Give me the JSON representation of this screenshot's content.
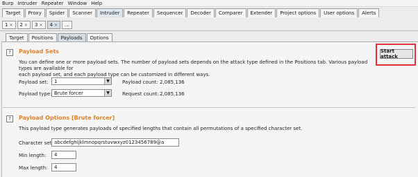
{
  "menubar": [
    "Burp",
    "Intruder",
    "Repeater",
    "Window",
    "Help"
  ],
  "main_tabs": [
    {
      "label": "Target",
      "active": false
    },
    {
      "label": "Proxy",
      "active": false
    },
    {
      "label": "Spider",
      "active": false
    },
    {
      "label": "Scanner",
      "active": false
    },
    {
      "label": "Intruder",
      "active": true
    },
    {
      "label": "Repeater",
      "active": false
    },
    {
      "label": "Sequencer",
      "active": false
    },
    {
      "label": "Decoder",
      "active": false
    },
    {
      "label": "Comparer",
      "active": false
    },
    {
      "label": "Extender",
      "active": false
    },
    {
      "label": "Project options",
      "active": false
    },
    {
      "label": "User options",
      "active": false
    },
    {
      "label": "Alerts",
      "active": false
    }
  ],
  "attack_tabs": [
    {
      "label": "1",
      "close": "×",
      "active": false
    },
    {
      "label": "2",
      "close": "×",
      "active": false
    },
    {
      "label": "3",
      "close": "×",
      "active": false
    },
    {
      "label": "4",
      "close": "×",
      "active": true
    },
    {
      "label": "...",
      "close": "",
      "active": false
    }
  ],
  "sub_tabs": [
    {
      "label": "Target",
      "active": false
    },
    {
      "label": "Positions",
      "active": false
    },
    {
      "label": "Payloads",
      "active": true
    },
    {
      "label": "Options",
      "active": false
    }
  ],
  "payload_sets": {
    "help": "?",
    "title": "Payload Sets",
    "description_line1": "You can define one or more payload sets. The number of payload sets depends on the attack type defined in the Positions tab. Various payload types are available for",
    "description_line2": "each payload set, and each payload type can be customized in different ways.",
    "set_label": "Payload set:",
    "set_value": "1",
    "type_label": "Payload type:",
    "type_value": "Brute forcer",
    "count_label": "Payload count:",
    "count_value": "2,085,136",
    "request_label": "Request count:",
    "request_value": "2,085,136",
    "start_attack": "Start attack"
  },
  "payload_options": {
    "help": "?",
    "title": "Payload Options [Brute forcer]",
    "description": "This payload type generates payloads of specified lengths that contain all permutations of a specified character set.",
    "charset_label": "Character set:",
    "charset_value": "abcdefghijklmnopqrstuvwxyz0123456789@a",
    "min_label": "Min length:",
    "min_value": "4",
    "max_label": "Max length:",
    "max_value": "4"
  },
  "colors": {
    "section_title": "#d9822b",
    "highlight_box": "#e0303a"
  },
  "icons": {
    "dropdown": "chevron-down-icon",
    "help": "help-icon"
  }
}
